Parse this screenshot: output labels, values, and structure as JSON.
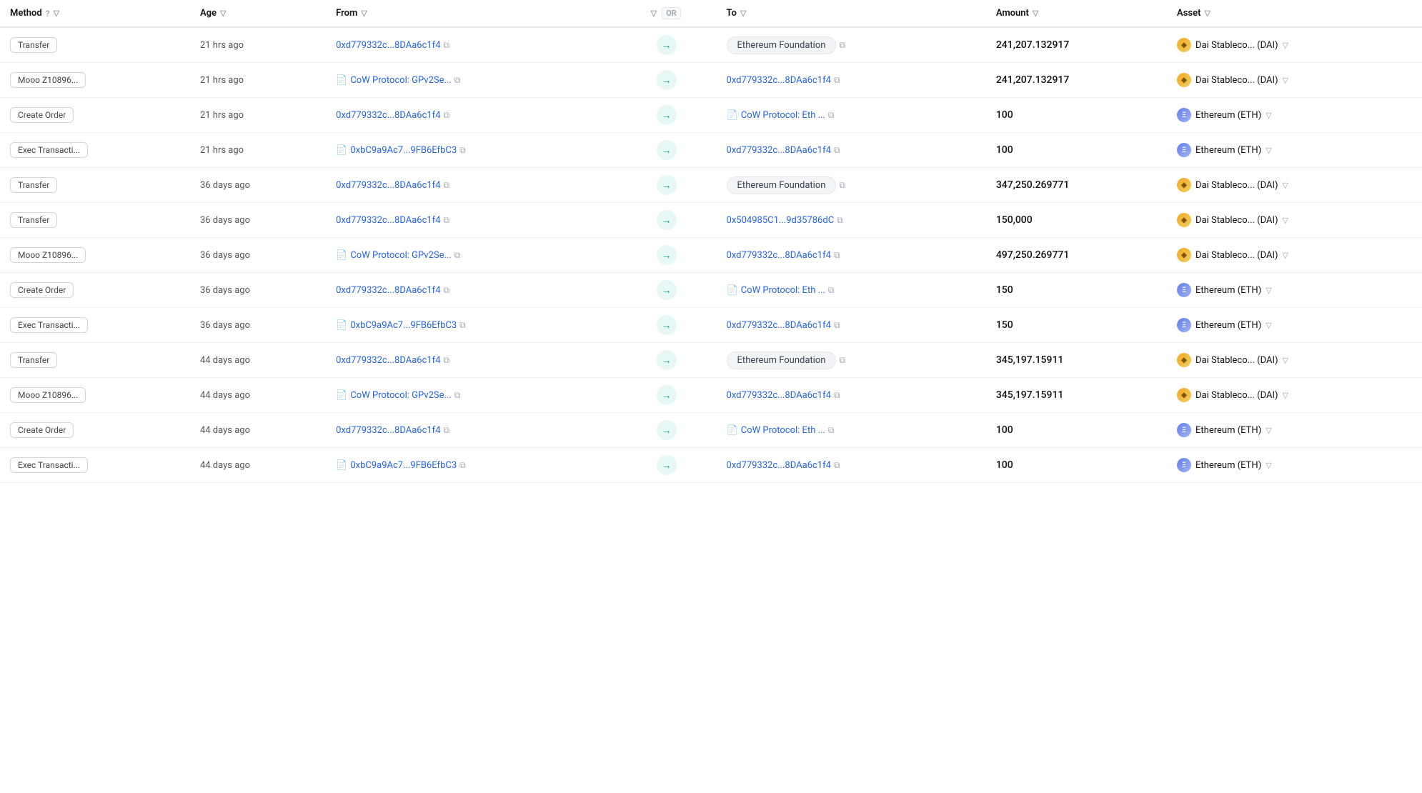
{
  "header": {
    "method_label": "Method",
    "age_label": "Age",
    "from_label": "From",
    "or_label": "OR",
    "to_label": "To",
    "amount_label": "Amount",
    "asset_label": "Asset"
  },
  "rows": [
    {
      "method": "Transfer",
      "age": "21 hrs ago",
      "from_type": "address",
      "from": "0xd779332c...8DAa6c1f4",
      "to_type": "badge",
      "to": "Ethereum Foundation",
      "amount": "241,207.132917",
      "asset_type": "dai",
      "asset": "Dai Stableco... (DAI)"
    },
    {
      "method": "Mooo Z1089​6...",
      "age": "21 hrs ago",
      "from_type": "doc",
      "from": "CoW Protocol: GPv2Se...",
      "to_type": "address",
      "to": "0xd779332c...8DAa6c1f4",
      "amount": "241,207.132917",
      "asset_type": "dai",
      "asset": "Dai Stableco... (DAI)"
    },
    {
      "method": "Create Order",
      "age": "21 hrs ago",
      "from_type": "address",
      "from": "0xd779332c...8DAa6c1f4",
      "to_type": "doc",
      "to": "CoW Protocol: Eth ...",
      "amount": "100",
      "asset_type": "eth",
      "asset": "Ethereum (ETH)"
    },
    {
      "method": "Exec Transacti...",
      "age": "21 hrs ago",
      "from_type": "doc",
      "from": "0xbC9a9Ac7...9FB6EfbC3",
      "to_type": "address",
      "to": "0xd779332c...8DAa6c1f4",
      "amount": "100",
      "asset_type": "eth",
      "asset": "Ethereum (ETH)"
    },
    {
      "method": "Transfer",
      "age": "36 days ago",
      "from_type": "address",
      "from": "0xd779332c...8DAa6c1f4",
      "to_type": "badge",
      "to": "Ethereum Foundation",
      "amount": "347,250.269771",
      "asset_type": "dai",
      "asset": "Dai Stableco... (DAI)"
    },
    {
      "method": "Transfer",
      "age": "36 days ago",
      "from_type": "address",
      "from": "0xd779332c...8DAa6c1f4",
      "to_type": "address",
      "to": "0x504985C1...9d35786dC",
      "amount": "150,000",
      "asset_type": "dai",
      "asset": "Dai Stableco... (DAI)"
    },
    {
      "method": "Mooo Z1089​6...",
      "age": "36 days ago",
      "from_type": "doc",
      "from": "CoW Protocol: GPv2Se...",
      "to_type": "address",
      "to": "0xd779332c...8DAa6c1f4",
      "amount": "497,250.269771",
      "asset_type": "dai",
      "asset": "Dai Stableco... (DAI)"
    },
    {
      "method": "Create Order",
      "age": "36 days ago",
      "from_type": "address",
      "from": "0xd779332c...8DAa6c1f4",
      "to_type": "doc",
      "to": "CoW Protocol: Eth ...",
      "amount": "150",
      "asset_type": "eth",
      "asset": "Ethereum (ETH)"
    },
    {
      "method": "Exec Transacti...",
      "age": "36 days ago",
      "from_type": "doc",
      "from": "0xbC9a9Ac7...9FB6EfbC3",
      "to_type": "address",
      "to": "0xd779332c...8DAa6c1f4",
      "amount": "150",
      "asset_type": "eth",
      "asset": "Ethereum (ETH)"
    },
    {
      "method": "Transfer",
      "age": "44 days ago",
      "from_type": "address",
      "from": "0xd779332c...8DAa6c1f4",
      "to_type": "badge",
      "to": "Ethereum Foundation",
      "amount": "345,197.15911",
      "asset_type": "dai",
      "asset": "Dai Stableco... (DAI)"
    },
    {
      "method": "Mooo Z1089​6...",
      "age": "44 days ago",
      "from_type": "doc",
      "from": "CoW Protocol: GPv2Se...",
      "to_type": "address",
      "to": "0xd779332c...8DAa6c1f4",
      "amount": "345,197.15911",
      "asset_type": "dai",
      "asset": "Dai Stableco... (DAI)"
    },
    {
      "method": "Create Order",
      "age": "44 days ago",
      "from_type": "address",
      "from": "0xd779332c...8DAa6c1f4",
      "to_type": "doc",
      "to": "CoW Protocol: Eth ...",
      "amount": "100",
      "asset_type": "eth",
      "asset": "Ethereum (ETH)"
    },
    {
      "method": "Exec Transacti...",
      "age": "44 days ago",
      "from_type": "doc",
      "from": "0xbC9a9Ac7...9FB6EfbC3",
      "to_type": "address",
      "to": "0xd779332c...8DAa6c1f4",
      "amount": "100",
      "asset_type": "eth",
      "asset": "Ethereum (ETH)"
    }
  ],
  "icons": {
    "filter": "▽",
    "copy": "⧉",
    "arrow": "→",
    "help": "?",
    "doc": "📄"
  }
}
